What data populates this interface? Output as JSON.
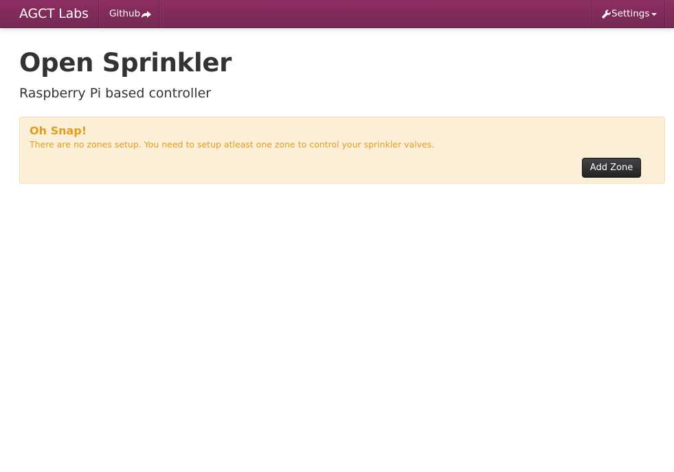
{
  "navbar": {
    "brand": "AGCT Labs",
    "links": [
      {
        "label": "Github",
        "icon": "share-arrow-icon"
      }
    ],
    "settings": {
      "label": "Settings",
      "icon": "wrench-icon"
    },
    "colors": {
      "bar": "#772953",
      "text": "#ffffff"
    }
  },
  "header": {
    "title": "Open Sprinkler",
    "subtitle": "Raspberry Pi based controller"
  },
  "alert": {
    "heading": "Oh Snap!",
    "message": "There are no zones setup. You need to setup atleast one zone to control your sprinkler valves.",
    "action_label": "Add Zone",
    "colors": {
      "background": "#fcefd7",
      "border": "#f6ddb4",
      "text": "#e39d1c"
    }
  }
}
